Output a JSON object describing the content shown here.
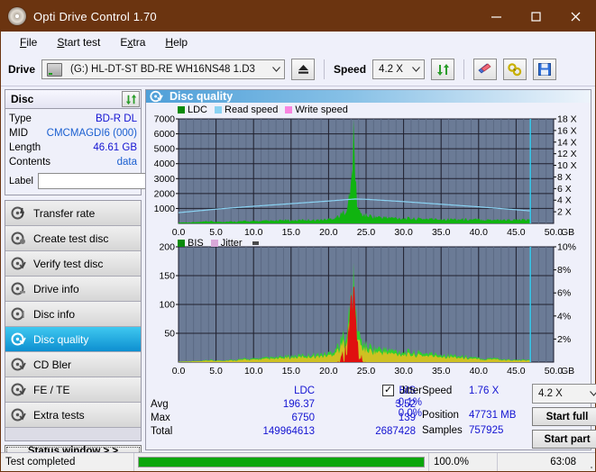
{
  "window": {
    "title": "Opti Drive Control 1.70",
    "icon": "disc-icon",
    "minimize": "−",
    "maximize": "□",
    "close": "✕"
  },
  "menu": {
    "items": [
      {
        "label": "File",
        "accel": "F"
      },
      {
        "label": "Start test",
        "accel": "S"
      },
      {
        "label": "Extra",
        "accel": "x"
      },
      {
        "label": "Help",
        "accel": "H"
      }
    ]
  },
  "drivebar": {
    "drive_label": "Drive",
    "drive_value": "(G:)  HL-DT-ST BD-RE  WH16NS48 1.D3",
    "eject_icon": "eject-icon",
    "speed_label": "Speed",
    "speed_value": "4.2 X",
    "refresh_icon": "refresh-icon",
    "erase_icon": "eraser-icon",
    "settings_icon": "tools-icon",
    "save_icon": "save-icon"
  },
  "disc": {
    "panel_title": "Disc",
    "refresh_icon": "refresh-icon",
    "rows": [
      {
        "key": "Type",
        "value": "BD-R DL"
      },
      {
        "key": "MID",
        "value": "CMCMAGDI6 (000)"
      },
      {
        "key": "Length",
        "value": "46.61 GB"
      },
      {
        "key": "Contents",
        "value": "data"
      }
    ],
    "label_key": "Label",
    "label_value": "",
    "label_placeholder": "",
    "label_button_icon": "disc-icon"
  },
  "nav": {
    "items": [
      {
        "label": "Transfer rate",
        "icon": "disc-rate-icon",
        "active": false
      },
      {
        "label": "Create test disc",
        "icon": "disc-create-icon",
        "active": false
      },
      {
        "label": "Verify test disc",
        "icon": "disc-verify-icon",
        "active": false
      },
      {
        "label": "Drive info",
        "icon": "drive-info-icon",
        "active": false
      },
      {
        "label": "Disc info",
        "icon": "disc-info-icon",
        "active": false
      },
      {
        "label": "Disc quality",
        "icon": "disc-quality-icon",
        "active": true
      },
      {
        "label": "CD Bler",
        "icon": "disc-bler-icon",
        "active": false
      },
      {
        "label": "FE / TE",
        "icon": "disc-fete-icon",
        "active": false
      },
      {
        "label": "Extra tests",
        "icon": "disc-extra-icon",
        "active": false
      }
    ],
    "status_button": "Status window > >"
  },
  "main": {
    "panel_title": "Disc quality",
    "panel_icon": "disc-quality-icon"
  },
  "chart_data": [
    {
      "type": "area",
      "name": "ldc-chart",
      "title": "",
      "xlabel": "GB",
      "ylabel": "",
      "xlim": [
        0,
        50
      ],
      "ylim": [
        0,
        7000
      ],
      "xticks": [
        "0.0",
        "5.0",
        "10.0",
        "15.0",
        "20.0",
        "25.0",
        "30.0",
        "35.0",
        "40.0",
        "45.0",
        "50.0"
      ],
      "yticks": [
        "1000",
        "2000",
        "3000",
        "4000",
        "5000",
        "6000",
        "7000"
      ],
      "y2lim": [
        0,
        18
      ],
      "y2ticks": [
        "2 X",
        "4 X",
        "6 X",
        "8 X",
        "10 X",
        "12 X",
        "14 X",
        "16 X",
        "18 X"
      ],
      "grid": true,
      "legend": [
        {
          "label": "LDC",
          "color": "#0a8a0a"
        },
        {
          "label": "Read speed",
          "color": "#8ad2f2"
        },
        {
          "label": "Write speed",
          "color": "#f985e0"
        }
      ],
      "series": [
        {
          "name": "LDC",
          "color": "#10b410",
          "x": [
            0,
            1,
            2,
            3,
            4,
            5,
            6,
            7,
            8,
            9,
            10,
            11,
            12,
            13,
            14,
            15,
            16,
            17,
            18,
            19,
            20,
            20.5,
            21,
            21.5,
            22,
            22.5,
            23,
            23.3,
            23.6,
            23.8,
            24,
            24.3,
            24.6,
            25,
            26,
            27,
            28,
            29,
            30,
            31,
            32,
            33,
            34,
            35,
            36,
            37,
            38,
            39,
            40,
            41,
            42,
            43,
            44,
            45,
            46,
            46.9
          ],
          "values": [
            60,
            75,
            80,
            95,
            150,
            110,
            120,
            130,
            140,
            160,
            150,
            165,
            180,
            175,
            230,
            200,
            220,
            260,
            240,
            250,
            300,
            360,
            430,
            560,
            760,
            1200,
            2400,
            6750,
            3000,
            1500,
            900,
            700,
            620,
            560,
            480,
            430,
            400,
            380,
            360,
            340,
            330,
            320,
            310,
            300,
            300,
            290,
            280,
            280,
            270,
            260,
            260,
            250,
            250,
            250,
            240,
            240
          ]
        },
        {
          "name": "Read speed",
          "color": "#8ad2f2",
          "x": [
            0,
            5,
            10,
            15,
            20,
            23.5,
            25,
            30,
            35,
            40,
            45,
            46.9
          ],
          "values": [
            1.85,
            2.45,
            2.95,
            3.4,
            3.85,
            4.2,
            4.15,
            3.75,
            3.3,
            2.85,
            2.35,
            2.15
          ]
        }
      ],
      "marker_line_x": 46.9,
      "marker_line_color": "#35cdf0"
    },
    {
      "type": "area",
      "name": "bis-jitter-chart",
      "title": "",
      "xlabel": "GB",
      "ylabel": "",
      "xlim": [
        0,
        50
      ],
      "ylim": [
        0,
        200
      ],
      "xticks": [
        "0.0",
        "5.0",
        "10.0",
        "15.0",
        "20.0",
        "25.0",
        "30.0",
        "35.0",
        "40.0",
        "45.0",
        "50.0"
      ],
      "yticks": [
        "50",
        "100",
        "150",
        "200"
      ],
      "y2lim": [
        0,
        10
      ],
      "y2ticks": [
        "2%",
        "4%",
        "6%",
        "8%",
        "10%"
      ],
      "grid": true,
      "legend": [
        {
          "label": "BIS",
          "color": "#0a8a0a"
        },
        {
          "label": "Jitter",
          "color": "#d9a8d9"
        }
      ],
      "series": [
        {
          "name": "BIS",
          "color": "#2fd02f",
          "x": [
            0,
            1,
            2,
            3,
            4,
            5,
            6,
            7,
            8,
            9,
            10,
            11,
            12,
            13,
            14,
            15,
            16,
            17,
            18,
            19,
            20,
            20.5,
            21,
            21.5,
            22,
            22.5,
            23,
            23.3,
            23.6,
            23.9,
            24.2,
            24.6,
            25,
            26,
            27,
            28,
            29,
            30,
            31,
            32,
            33,
            34,
            35,
            36,
            37,
            38,
            39,
            40,
            41,
            42,
            43,
            44,
            45,
            46,
            46.9
          ],
          "values": [
            1,
            1.5,
            2,
            2,
            4,
            3,
            3.5,
            4,
            5,
            6,
            6,
            7,
            8,
            8,
            10,
            11,
            12,
            13,
            14,
            14,
            16,
            20,
            26,
            34,
            48,
            62,
            110,
            139,
            95,
            60,
            44,
            36,
            30,
            26,
            24,
            22,
            20,
            19,
            18,
            17,
            16,
            15,
            14,
            13,
            12,
            10,
            9,
            7,
            6,
            9,
            5,
            5,
            4,
            4,
            4
          ]
        }
      ],
      "marker_line_x": 46.9,
      "marker_line_color": "#35cdf0",
      "annotation_marker": "dark-block"
    }
  ],
  "stats": {
    "headers": [
      "",
      "LDC",
      "BIS"
    ],
    "rows": [
      {
        "key": "Avg",
        "ldc": "196.37",
        "bis": "3.52",
        "jitter": "-0.1%"
      },
      {
        "key": "Max",
        "ldc": "6750",
        "bis": "139",
        "jitter": "0.0%"
      },
      {
        "key": "Total",
        "ldc": "149964613",
        "bis": "2687428",
        "jitter": ""
      }
    ],
    "jitter_label": "Jitter",
    "jitter_checked": true,
    "jitter_check_glyph": "✓",
    "speed_key": "Speed",
    "speed_value": "1.76 X",
    "position_key": "Position",
    "position_value": "47731 MB",
    "samples_key": "Samples",
    "samples_value": "757925",
    "speed_select": "4.2 X",
    "start_full": "Start full",
    "start_part": "Start part"
  },
  "statusbar": {
    "message": "Test completed",
    "progress_pct": 100,
    "progress_text": "100.0%",
    "elapsed": "63:08"
  },
  "colors": {
    "titlebar": "#6b3410",
    "accent": "#0d8fd0",
    "plot_bg": "#6b7b96",
    "value_text": "#1414d2",
    "progress": "#0ba60b"
  }
}
